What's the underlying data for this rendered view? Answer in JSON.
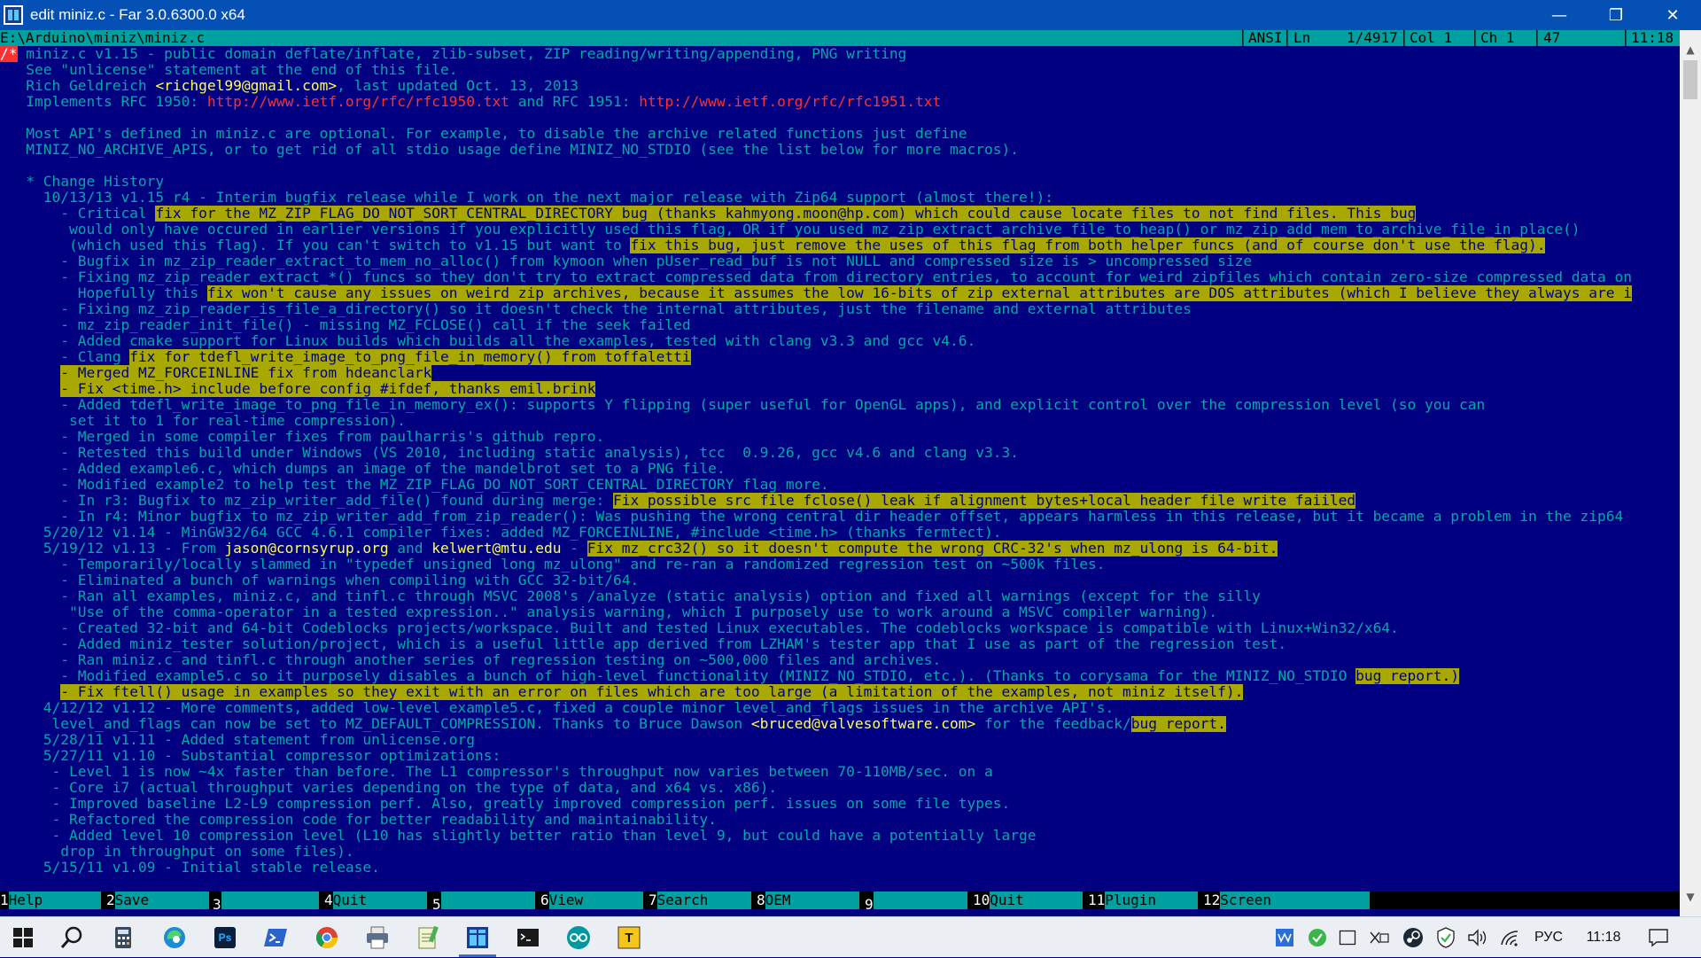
{
  "window": {
    "title": "edit miniz.c - Far 3.0.6300.0 x64",
    "minimize_glyph": "—",
    "maximize_glyph": "❐",
    "close_glyph": "✕"
  },
  "status": {
    "path": "E:\\Arduino\\miniz\\miniz.c",
    "codepage": "ANSI",
    "ln_label": "Ln",
    "ln_value": "1/4917",
    "col": "Col 1",
    "ch": "Ch 1",
    "char_code": "47",
    "clock": "11:18"
  },
  "editor": {
    "lines": [
      [
        {
          "t": "/*",
          "cls": "cursor"
        },
        {
          "t": " miniz.c v1.15 - public domain deflate/inflate, zlib-subset, ZIP reading/writing/appending, PNG writing"
        }
      ],
      [
        {
          "t": "   See \"unlicense\" statement at the end of this file."
        }
      ],
      [
        {
          "t": "   Rich Geldreich "
        },
        {
          "t": "<richgel99@gmail.com>",
          "cls": "email"
        },
        {
          "t": ", last updated Oct. 13, 2013"
        }
      ],
      [
        {
          "t": "   Implements RFC 1950: "
        },
        {
          "t": "http://www.ietf.org/rfc/rfc1950.txt",
          "cls": "url"
        },
        {
          "t": " and RFC 1951: "
        },
        {
          "t": "http://www.ietf.org/rfc/rfc1951.txt",
          "cls": "url"
        }
      ],
      [
        {
          "t": ""
        }
      ],
      [
        {
          "t": "   Most API's defined in miniz.c are optional. For example, to disable the archive related functions just define"
        }
      ],
      [
        {
          "t": "   MINIZ_NO_ARCHIVE_APIS, or to get rid of all stdio usage define MINIZ_NO_STDIO (see the list below for more macros)."
        }
      ],
      [
        {
          "t": ""
        }
      ],
      [
        {
          "t": "   * Change History"
        }
      ],
      [
        {
          "t": "     10/13/13 v1.15 r4 - Interim bugfix release while I work on the next major release with Zip64 support (almost there!):"
        }
      ],
      [
        {
          "t": "       - Critical "
        },
        {
          "t": "fix for the MZ_ZIP_FLAG_DO_NOT_SORT_CENTRAL_DIRECTORY bug (thanks kahmyong.moon@hp.com) which could cause locate files to not find files. This bug",
          "cls": "hl"
        }
      ],
      [
        {
          "t": "        would only have occured in earlier versions if you explicitly used this flag, OR if you used mz_zip_extract_archive_file_to_heap() or mz_zip_add_mem_to_archive_file_in_place()"
        }
      ],
      [
        {
          "t": "        (which used this flag). If you can't switch to v1.15 but want to "
        },
        {
          "t": "fix this bug, just remove the uses of this flag from both helper funcs (and of course don't use the flag).",
          "cls": "hl"
        }
      ],
      [
        {
          "t": "       - Bugfix in mz_zip_reader_extract_to_mem_no_alloc() from kymoon when pUser_read_buf is not NULL and compressed size is > uncompressed size"
        }
      ],
      [
        {
          "t": "       - Fixing mz_zip_reader_extract_*() funcs so they don't try to extract compressed data from directory entries, to account for weird zipfiles which contain zero-size compressed data on"
        }
      ],
      [
        {
          "t": "         Hopefully this "
        },
        {
          "t": "fix won't cause any issues on weird zip archives, because it assumes the low 16-bits of zip external attributes are DOS attributes (which I believe they always are i",
          "cls": "hl"
        }
      ],
      [
        {
          "t": "       - Fixing mz_zip_reader_is_file_a_directory() so it doesn't check the internal attributes, just the filename and external attributes"
        }
      ],
      [
        {
          "t": "       - mz_zip_reader_init_file() - missing MZ_FCLOSE() call if the seek failed"
        }
      ],
      [
        {
          "t": "       - Added cmake support for Linux builds which builds all the examples, tested with clang v3.3 and gcc v4.6."
        }
      ],
      [
        {
          "t": "       - Clang "
        },
        {
          "t": "fix for tdefl_write_image_to_png_file_in_memory() from toffaletti",
          "cls": "hl"
        }
      ],
      [
        {
          "t": "       "
        },
        {
          "t": "- Merged MZ_FORCEINLINE ",
          "cls": "hl"
        },
        {
          "t": "fix from hdeanclark",
          "cls": "hl"
        }
      ],
      [
        {
          "t": "       "
        },
        {
          "t": "- Fix <time.h> include before config #ifdef, thanks emil.brink",
          "cls": "hl"
        }
      ],
      [
        {
          "t": "       - Added tdefl_write_image_to_png_file_in_memory_ex(): supports Y flipping (super useful for OpenGL apps), and explicit control over the compression level (so you can"
        }
      ],
      [
        {
          "t": "        set it to 1 for real-time compression)."
        }
      ],
      [
        {
          "t": "       - Merged in some compiler fixes from paulharris's github repro."
        }
      ],
      [
        {
          "t": "       - Retested this build under Windows (VS 2010, including static analysis), tcc  0.9.26, gcc v4.6 and clang v3.3."
        }
      ],
      [
        {
          "t": "       - Added example6.c, which dumps an image of the mandelbrot set to a PNG file."
        }
      ],
      [
        {
          "t": "       - Modified example2 to help test the MZ_ZIP_FLAG_DO_NOT_SORT_CENTRAL_DIRECTORY flag more."
        }
      ],
      [
        {
          "t": "       - In r3: Bugfix to mz_zip_writer_add_file() found during merge: "
        },
        {
          "t": "Fix possible src file fclose() leak if alignment bytes+local header file write faiiled",
          "cls": "hl"
        }
      ],
      [
        {
          "t": "       - In r4: Minor bugfix to mz_zip_writer_add_from_zip_reader(): Was pushing the wrong central dir header offset, appears harmless in this release, but it became a problem in the zip64"
        }
      ],
      [
        {
          "t": "     5/20/12 v1.14 - MinGW32/64 GCC 4.6.1 compiler fixes: added MZ_FORCEINLINE, #include <time.h> (thanks fermtect)."
        }
      ],
      [
        {
          "t": "     5/19/12 v1.13 - From "
        },
        {
          "t": "jason@cornsyrup.org",
          "cls": "email"
        },
        {
          "t": " and "
        },
        {
          "t": "kelwert@mtu.edu",
          "cls": "email"
        },
        {
          "t": " - "
        },
        {
          "t": "Fix mz_crc32() so it doesn't compute the wrong CRC-32's when mz_ulong is 64-bit.",
          "cls": "hl"
        }
      ],
      [
        {
          "t": "       - Temporarily/locally slammed in \"typedef unsigned long mz_ulong\" and re-ran a randomized regression test on ~500k files."
        }
      ],
      [
        {
          "t": "       - Eliminated a bunch of warnings when compiling with GCC 32-bit/64."
        }
      ],
      [
        {
          "t": "       - Ran all examples, miniz.c, and tinfl.c through MSVC 2008's /analyze (static analysis) option and fixed all warnings (except for the silly"
        }
      ],
      [
        {
          "t": "        \"Use of the comma-operator in a tested expression..\" analysis warning, which I purposely use to work around a MSVC compiler warning)."
        }
      ],
      [
        {
          "t": "       - Created 32-bit and 64-bit Codeblocks projects/workspace. Built and tested Linux executables. The codeblocks workspace is compatible with Linux+Win32/x64."
        }
      ],
      [
        {
          "t": "       - Added miniz_tester solution/project, which is a useful little app derived from LZHAM's tester app that I use as part of the regression test."
        }
      ],
      [
        {
          "t": "       - Ran miniz.c and tinfl.c through another series of regression testing on ~500,000 files and archives."
        }
      ],
      [
        {
          "t": "       - Modified example5.c so it purposely disables a bunch of high-level functionality (MINIZ_NO_STDIO, etc.). (Thanks to corysama for the MINIZ_NO_STDIO "
        },
        {
          "t": "bug report.)",
          "cls": "hl"
        }
      ],
      [
        {
          "t": "       "
        },
        {
          "t": "- Fix ftell() usage in examples so they exit with an error on files which are too large (a limitation of the examples, not miniz itself).",
          "cls": "hl"
        }
      ],
      [
        {
          "t": "     4/12/12 v1.12 - More comments, added low-level example5.c, fixed a couple minor level_and_flags issues in the archive API's."
        }
      ],
      [
        {
          "t": "      level_and_flags can now be set to MZ_DEFAULT_COMPRESSION. Thanks to Bruce Dawson "
        },
        {
          "t": "<bruced@valvesoftware.com>",
          "cls": "email"
        },
        {
          "t": " for the feedback/"
        },
        {
          "t": "bug report.",
          "cls": "hl"
        }
      ],
      [
        {
          "t": "     5/28/11 v1.11 - Added statement from unlicense.org"
        }
      ],
      [
        {
          "t": "     5/27/11 v1.10 - Substantial compressor optimizations:"
        }
      ],
      [
        {
          "t": "      - Level 1 is now ~4x faster than before. The L1 compressor's throughput now varies between 70-110MB/sec. on a"
        }
      ],
      [
        {
          "t": "      - Core i7 (actual throughput varies depending on the type of data, and x64 vs. x86)."
        }
      ],
      [
        {
          "t": "      - Improved baseline L2-L9 compression perf. Also, greatly improved compression perf. issues on some file types."
        }
      ],
      [
        {
          "t": "      - Refactored the compression code for better readability and maintainability."
        }
      ],
      [
        {
          "t": "      - Added level 10 compression level (L10 has slightly better ratio than level 9, but could have a potentially large"
        }
      ],
      [
        {
          "t": "       drop in throughput on some files)."
        }
      ],
      [
        {
          "t": "     5/15/11 v1.09 - Initial stable release."
        }
      ]
    ]
  },
  "keybar": [
    {
      "num": "1",
      "label": "Help"
    },
    {
      "num": "2",
      "label": "Save"
    },
    {
      "num": "3",
      "label": ""
    },
    {
      "num": "4",
      "label": "Quit"
    },
    {
      "num": "5",
      "label": ""
    },
    {
      "num": "6",
      "label": "View"
    },
    {
      "num": "7",
      "label": "Search"
    },
    {
      "num": "8",
      "label": "OEM"
    },
    {
      "num": "9",
      "label": ""
    },
    {
      "num": "10",
      "label": "Quit"
    },
    {
      "num": "11",
      "label": "Plugin"
    },
    {
      "num": "12",
      "label": "Screen"
    }
  ],
  "scrollbar": {
    "position_fraction": 0.0,
    "up_glyph": "▲",
    "down_glyph": "▼"
  },
  "taskbar": {
    "apps": [
      {
        "name": "start-icon"
      },
      {
        "name": "search-icon"
      },
      {
        "name": "calculator-icon"
      },
      {
        "name": "edge-icon"
      },
      {
        "name": "photoshop-icon",
        "text": "Ps"
      },
      {
        "name": "powershell-icon"
      },
      {
        "name": "chrome-icon"
      },
      {
        "name": "printer-icon"
      },
      {
        "name": "notepad-icon"
      },
      {
        "name": "far-manager-icon",
        "active": true
      },
      {
        "name": "terminal-icon"
      },
      {
        "name": "arduino-icon"
      },
      {
        "name": "typora-icon",
        "text": "T"
      }
    ],
    "tray": {
      "language": "РУС",
      "clock": "11:18"
    }
  },
  "colors": {
    "editor_bg": "#000080",
    "text": "#00a8a8",
    "highlight_bg": "#a8a800",
    "url": "#ff3030",
    "email": "#ffff55",
    "status_bg": "#00a0a0",
    "titlebar_bg": "#0550b5"
  }
}
